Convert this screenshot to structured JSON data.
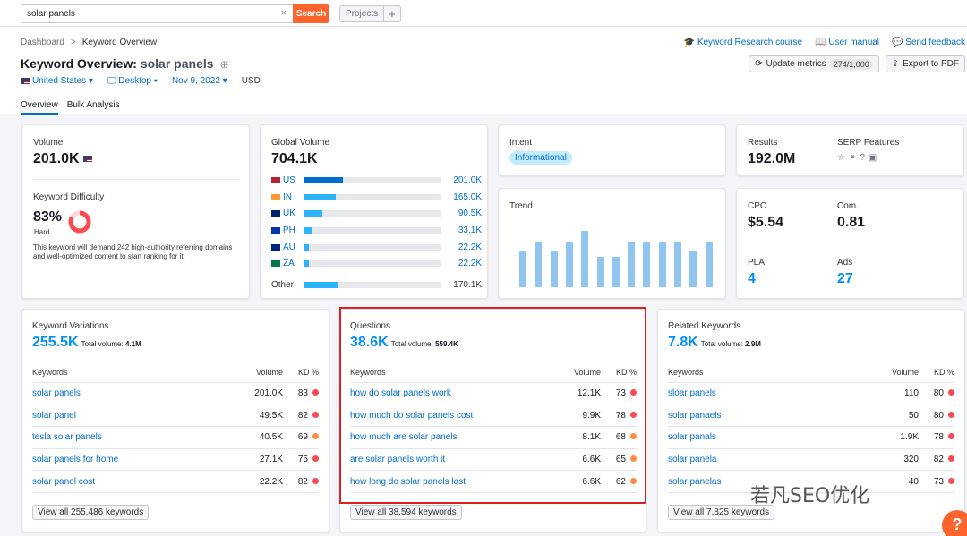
{
  "search": {
    "value": "solar panels",
    "button": "Search",
    "clear": "×"
  },
  "projects": {
    "label": "Projects",
    "plus": "+"
  },
  "breadcrumb": {
    "home": "Dashboard",
    "sep": ">",
    "current": "Keyword Overview"
  },
  "title": {
    "prefix": "Keyword Overview:",
    "keyword": "solar panels",
    "add": "⊕"
  },
  "filters": {
    "country": "United States",
    "device": "Desktop",
    "date": "Nov 9, 2022",
    "currency": "USD"
  },
  "tabs": [
    "Overview",
    "Bulk Analysis"
  ],
  "top_links": {
    "course": "Keyword Research course",
    "manual": "User manual",
    "feedback": "Send feedback"
  },
  "actions": {
    "update": "Update metrics",
    "update_count": "274/1,000",
    "export": "Export to PDF"
  },
  "volume": {
    "label": "Volume",
    "value": "201.0K"
  },
  "kd": {
    "label": "Keyword Difficulty",
    "value": "83%",
    "level": "Hard",
    "percent": 83,
    "note": "This keyword will demand 242 high-authority referring domains and well-optimized content to start ranking for it."
  },
  "global": {
    "label": "Global Volume",
    "value": "704.1K",
    "rows": [
      {
        "cc": "US",
        "val": "201.0K",
        "frac": 0.28,
        "color": "#006dca"
      },
      {
        "cc": "IN",
        "val": "165.0K",
        "frac": 0.23,
        "color": "#2bb3ff"
      },
      {
        "cc": "UK",
        "val": "90.5K",
        "frac": 0.13,
        "color": "#2bb3ff"
      },
      {
        "cc": "PH",
        "val": "33.1K",
        "frac": 0.05,
        "color": "#2bb3ff"
      },
      {
        "cc": "AU",
        "val": "22.2K",
        "frac": 0.035,
        "color": "#2bb3ff"
      },
      {
        "cc": "ZA",
        "val": "22.2K",
        "frac": 0.035,
        "color": "#2bb3ff"
      },
      {
        "cc": "Other",
        "val": "170.1K",
        "frac": 0.24,
        "color": "#2bb3ff"
      }
    ]
  },
  "intent": {
    "label": "Intent",
    "value": "Informational"
  },
  "trend": {
    "label": "Trend",
    "values": [
      0.5,
      0.63,
      0.5,
      0.63,
      0.79,
      0.42,
      0.42,
      0.63,
      0.63,
      0.63,
      0.63,
      0.5,
      0.63
    ]
  },
  "results": {
    "label": "Results",
    "value": "192.0M"
  },
  "serp": {
    "label": "SERP Features",
    "icons": [
      "star-icon",
      "link-icon",
      "question-icon",
      "image-icon"
    ]
  },
  "cpc": {
    "label": "CPC",
    "value": "$5.54"
  },
  "com": {
    "label": "Com.",
    "value": "0.81"
  },
  "pla": {
    "label": "PLA",
    "value": "4"
  },
  "ads": {
    "label": "Ads",
    "value": "27"
  },
  "variations": {
    "title": "Keyword Variations",
    "count": "255.5K",
    "tv_label": "Total volume:",
    "tv": "4.1M",
    "h_kw": "Keywords",
    "h_vol": "Volume",
    "h_kd": "KD %",
    "rows": [
      {
        "k": "solar panels",
        "v": "201.0K",
        "d": "83",
        "c": "#ff4953"
      },
      {
        "k": "solar panel",
        "v": "49.5K",
        "d": "82",
        "c": "#ff4953"
      },
      {
        "k": "tesla solar panels",
        "v": "40.5K",
        "d": "69",
        "c": "#ff8c43"
      },
      {
        "k": "solar panels for home",
        "v": "27.1K",
        "d": "75",
        "c": "#ff4953"
      },
      {
        "k": "solar panel cost",
        "v": "22.2K",
        "d": "82",
        "c": "#ff4953"
      }
    ],
    "view_all": "View all 255,486 keywords"
  },
  "questions": {
    "title": "Questions",
    "count": "38.6K",
    "tv_label": "Total volume:",
    "tv": "559.4K",
    "h_kw": "Keywords",
    "h_vol": "Volume",
    "h_kd": "KD %",
    "rows": [
      {
        "k": "how do solar panels work",
        "v": "12.1K",
        "d": "73",
        "c": "#ff4953"
      },
      {
        "k": "how much do solar panels cost",
        "v": "9.9K",
        "d": "78",
        "c": "#ff4953"
      },
      {
        "k": "how much are solar panels",
        "v": "8.1K",
        "d": "68",
        "c": "#ff8c43"
      },
      {
        "k": "are solar panels worth it",
        "v": "6.6K",
        "d": "65",
        "c": "#ff8c43"
      },
      {
        "k": "how long do solar panels last",
        "v": "6.6K",
        "d": "62",
        "c": "#ff8c43"
      }
    ],
    "view_all": "View all 38,594 keywords"
  },
  "related": {
    "title": "Related Keywords",
    "count": "7.8K",
    "tv_label": "Total volume:",
    "tv": "2.9M",
    "h_kw": "Keywords",
    "h_vol": "Volume",
    "h_kd": "KD %",
    "rows": [
      {
        "k": "sloar panels",
        "v": "110",
        "d": "80",
        "c": "#ff4953"
      },
      {
        "k": "solar panaels",
        "v": "50",
        "d": "80",
        "c": "#ff4953"
      },
      {
        "k": "solar panals",
        "v": "1.9K",
        "d": "78",
        "c": "#ff4953"
      },
      {
        "k": "solar panela",
        "v": "320",
        "d": "82",
        "c": "#ff4953"
      },
      {
        "k": "solar panelas",
        "v": "40",
        "d": "73",
        "c": "#ff4953"
      }
    ],
    "view_all": "View all 7,825 keywords"
  },
  "watermark": "若凡SEO优化",
  "help": "?"
}
